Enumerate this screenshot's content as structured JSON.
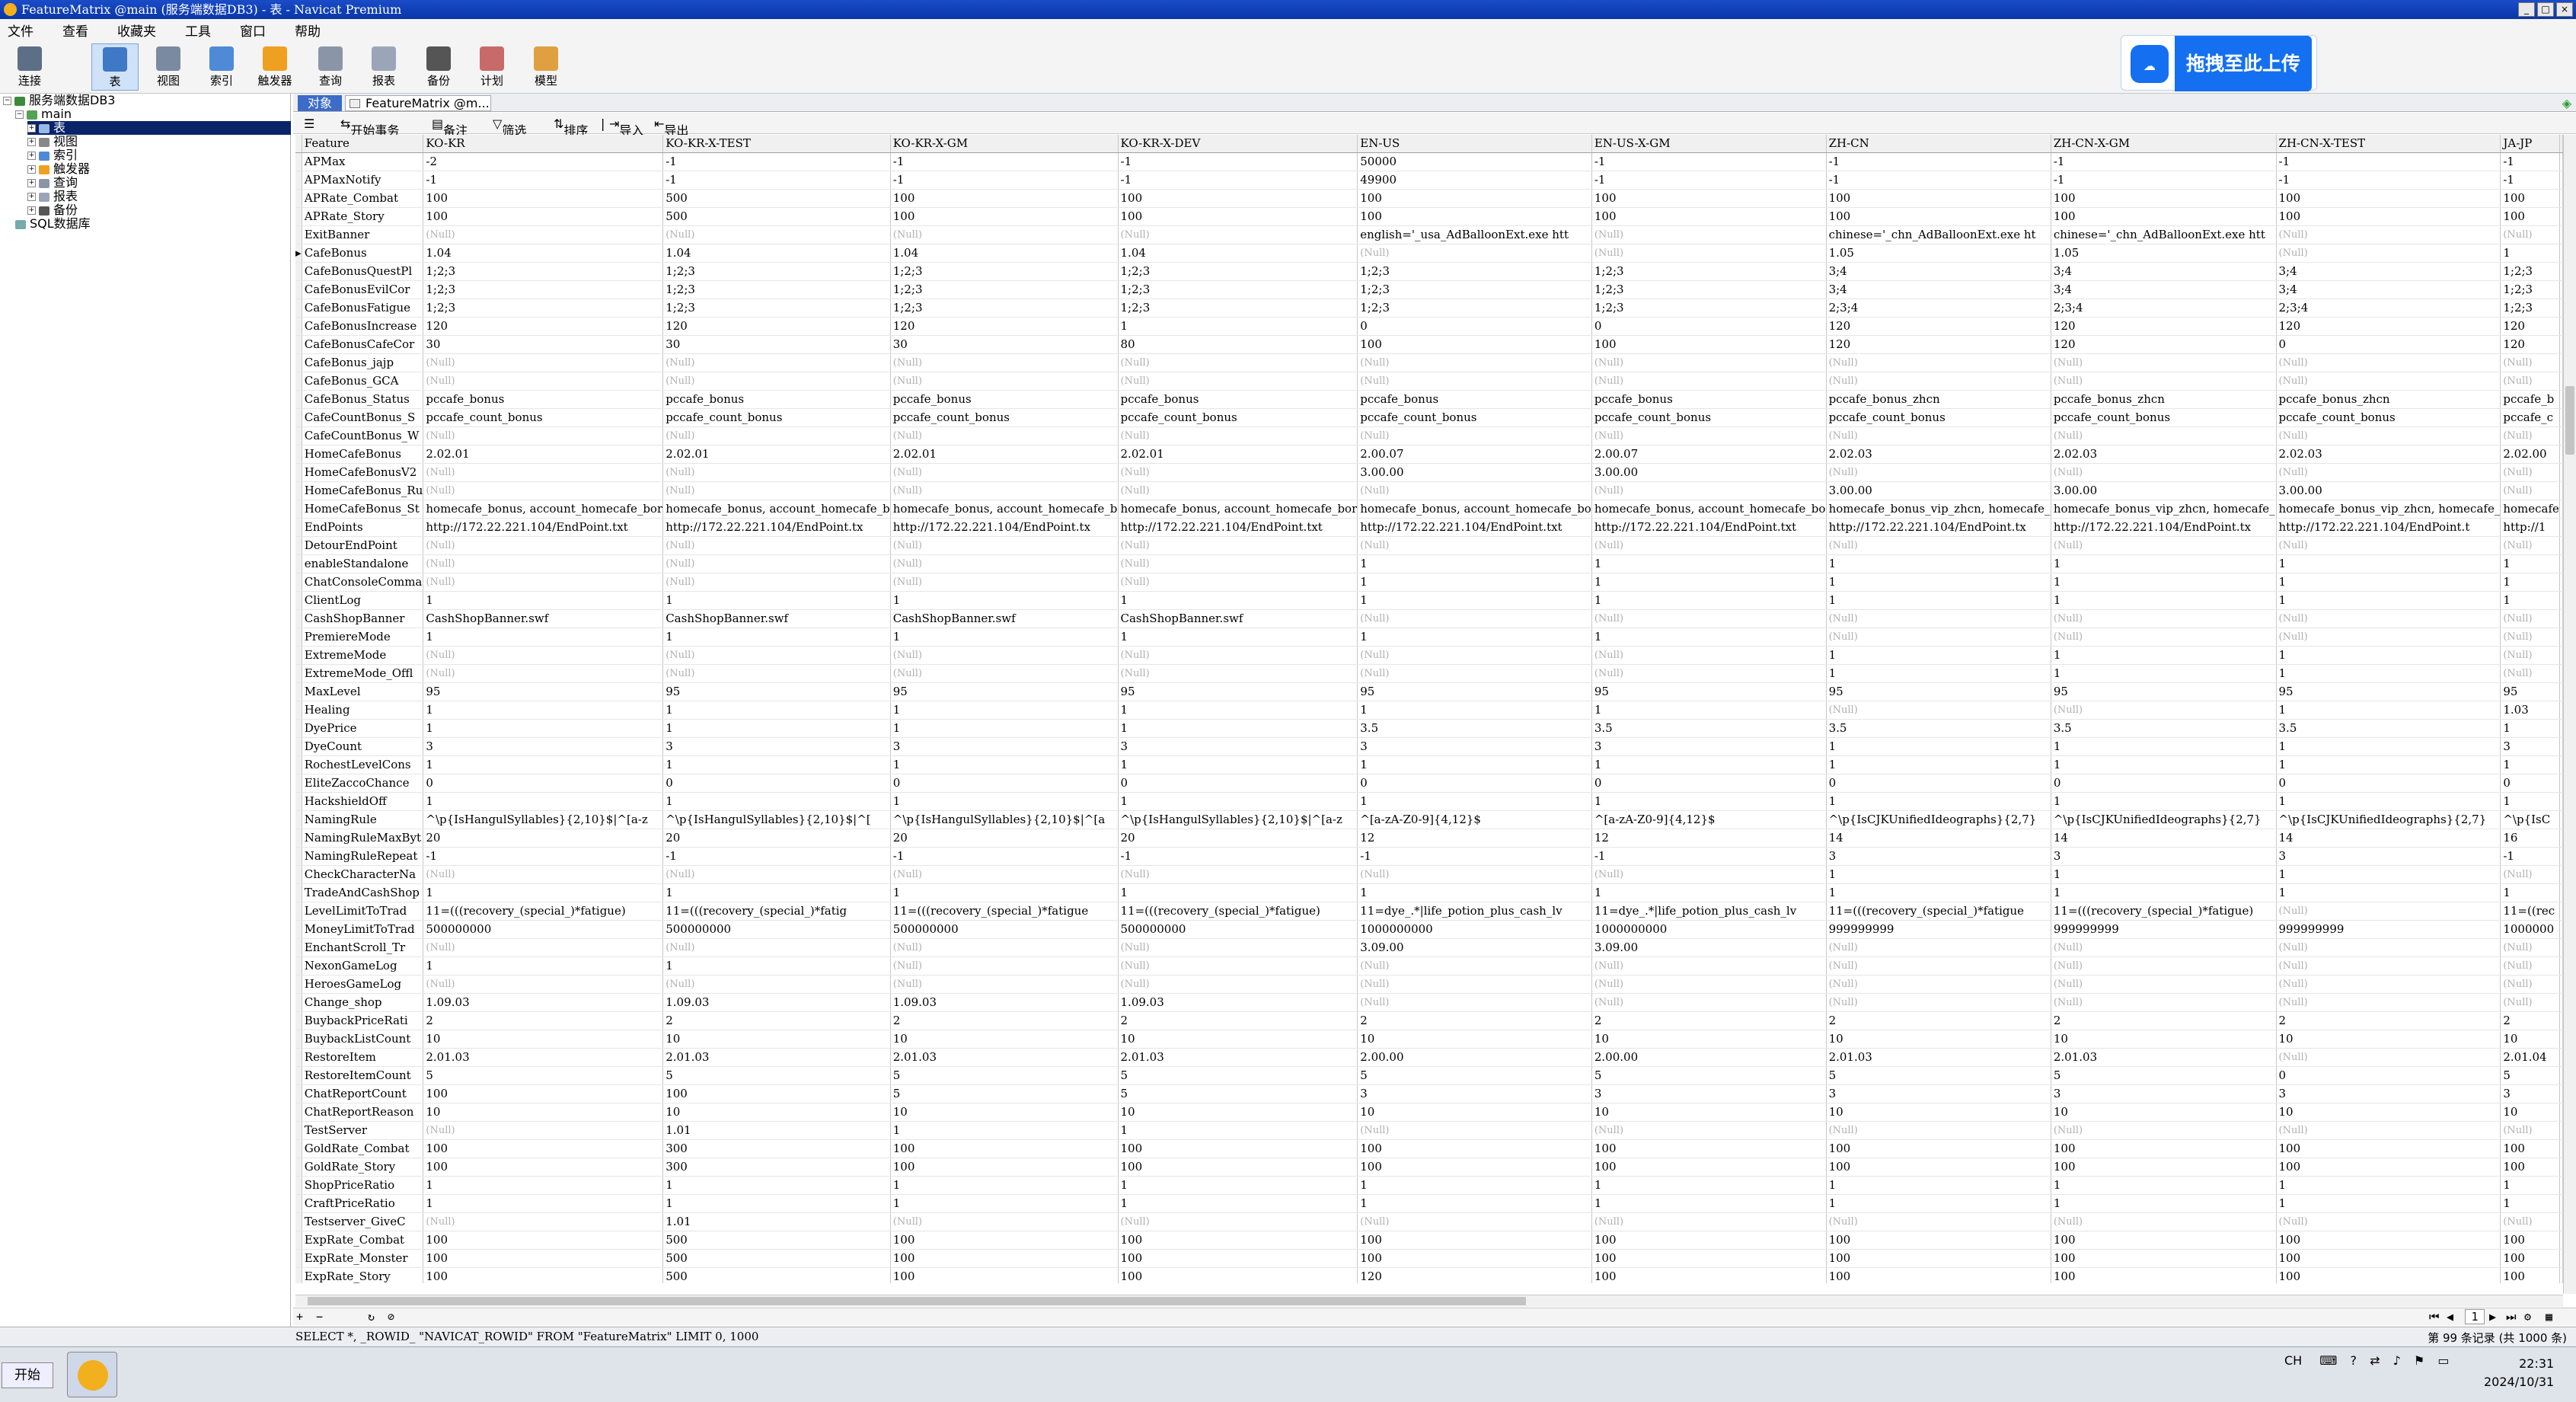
{
  "window": {
    "title": "FeatureMatrix @main (服务端数据DB3) - 表 - Navicat Premium"
  },
  "menu": [
    "文件",
    "查看",
    "收藏夹",
    "工具",
    "窗口",
    "帮助"
  ],
  "toolbar": [
    "连接",
    "表",
    "视图",
    "索引",
    "触发器",
    "查询",
    "报表",
    "备份",
    "计划",
    "模型"
  ],
  "upload": {
    "label": "拖拽至此上传"
  },
  "tree": [
    {
      "label": "服务端数据DB3",
      "level": 0
    },
    {
      "label": "main",
      "level": 1
    },
    {
      "label": "表",
      "level": 2
    },
    {
      "label": "视图",
      "level": 2
    },
    {
      "label": "索引",
      "level": 2
    },
    {
      "label": "触发器",
      "level": 2
    },
    {
      "label": "查询",
      "level": 2
    },
    {
      "label": "报表",
      "level": 2
    },
    {
      "label": "备份",
      "level": 2
    },
    {
      "label": "SQL数据库",
      "level": 0
    }
  ],
  "tabs": {
    "objects": "对象",
    "table": "FeatureMatrix @m..."
  },
  "objbar": {
    "begin": "开始事务",
    "note": "备注",
    "filter": "筛选",
    "sort": "排序",
    "import": "导入",
    "export": "导出"
  },
  "grid": {
    "columns": [
      "Feature",
      "KO-KR",
      "KO-KR-X-TEST",
      "KO-KR-X-GM",
      "KO-KR-X-DEV",
      "EN-US",
      "EN-US-X-GM",
      "ZH-CN",
      "ZH-CN-X-GM",
      "ZH-CN-X-TEST",
      "JA-JP"
    ],
    "rows": [
      [
        "APMax",
        "-2",
        "-1",
        "-1",
        "-1",
        "50000",
        "-1",
        "-1",
        "-1",
        "-1",
        "-1"
      ],
      [
        "APMaxNotify",
        "-1",
        "-1",
        "-1",
        "-1",
        "49900",
        "-1",
        "-1",
        "-1",
        "-1",
        "-1"
      ],
      [
        "APRate_Combat",
        "100",
        "500",
        "100",
        "100",
        "100",
        "100",
        "100",
        "100",
        "100",
        "100"
      ],
      [
        "APRate_Story",
        "100",
        "500",
        "100",
        "100",
        "100",
        "100",
        "100",
        "100",
        "100",
        "100"
      ],
      [
        "ExitBanner",
        "(Null)",
        "(Null)",
        "(Null)",
        "(Null)",
        "english='_usa_AdBalloonExt.exe htt",
        "(Null)",
        "chinese='_chn_AdBalloonExt.exe ht",
        "chinese='_chn_AdBalloonExt.exe htt",
        "(Null)",
        "(Null)"
      ],
      [
        "CafeBonus",
        "1.04",
        "1.04",
        "1.04",
        "1.04",
        "(Null)",
        "(Null)",
        "1.05",
        "1.05",
        "(Null)",
        "1"
      ],
      [
        "CafeBonusQuestPl",
        "1;2;3",
        "1;2;3",
        "1;2;3",
        "1;2;3",
        "1;2;3",
        "1;2;3",
        "3;4",
        "3;4",
        "3;4",
        "1;2;3"
      ],
      [
        "CafeBonusEvilCor",
        "1;2;3",
        "1;2;3",
        "1;2;3",
        "1;2;3",
        "1;2;3",
        "1;2;3",
        "3;4",
        "3;4",
        "3;4",
        "1;2;3"
      ],
      [
        "CafeBonusFatigue",
        "1;2;3",
        "1;2;3",
        "1;2;3",
        "1;2;3",
        "1;2;3",
        "1;2;3",
        "2;3;4",
        "2;3;4",
        "2;3;4",
        "1;2;3"
      ],
      [
        "CafeBonusIncrease",
        "120",
        "120",
        "120",
        "1",
        "0",
        "0",
        "120",
        "120",
        "120",
        "120"
      ],
      [
        "CafeBonusCafeCor",
        "30",
        "30",
        "30",
        "80",
        "100",
        "100",
        "120",
        "120",
        "0",
        "120"
      ],
      [
        "CafeBonus_jajp",
        "(Null)",
        "(Null)",
        "(Null)",
        "(Null)",
        "(Null)",
        "(Null)",
        "(Null)",
        "(Null)",
        "(Null)",
        "(Null)"
      ],
      [
        "CafeBonus_GCA",
        "(Null)",
        "(Null)",
        "(Null)",
        "(Null)",
        "(Null)",
        "(Null)",
        "(Null)",
        "(Null)",
        "(Null)",
        "(Null)"
      ],
      [
        "CafeBonus_Status",
        "pccafe_bonus",
        "pccafe_bonus",
        "pccafe_bonus",
        "pccafe_bonus",
        "pccafe_bonus",
        "pccafe_bonus",
        "pccafe_bonus_zhcn",
        "pccafe_bonus_zhcn",
        "pccafe_bonus_zhcn",
        "pccafe_b"
      ],
      [
        "CafeCountBonus_S",
        "pccafe_count_bonus",
        "pccafe_count_bonus",
        "pccafe_count_bonus",
        "pccafe_count_bonus",
        "pccafe_count_bonus",
        "pccafe_count_bonus",
        "pccafe_count_bonus",
        "pccafe_count_bonus",
        "pccafe_count_bonus",
        "pccafe_c"
      ],
      [
        "CafeCountBonus_W",
        "(Null)",
        "(Null)",
        "(Null)",
        "(Null)",
        "(Null)",
        "(Null)",
        "(Null)",
        "(Null)",
        "(Null)",
        "(Null)"
      ],
      [
        "HomeCafeBonus",
        "2.02.01",
        "2.02.01",
        "2.02.01",
        "2.02.01",
        "2.00.07",
        "2.00.07",
        "2.02.03",
        "2.02.03",
        "2.02.03",
        "2.02.00"
      ],
      [
        "HomeCafeBonusV2",
        "(Null)",
        "(Null)",
        "(Null)",
        "(Null)",
        "3.00.00",
        "3.00.00",
        "(Null)",
        "(Null)",
        "(Null)",
        "(Null)"
      ],
      [
        "HomeCafeBonus_Ru",
        "(Null)",
        "(Null)",
        "(Null)",
        "(Null)",
        "(Null)",
        "(Null)",
        "3.00.00",
        "3.00.00",
        "3.00.00",
        "(Null)"
      ],
      [
        "HomeCafeBonus_St",
        "homecafe_bonus, account_homecafe_bor",
        "homecafe_bonus, account_homecafe_b",
        "homecafe_bonus, account_homecafe_b",
        "homecafe_bonus, account_homecafe_bor",
        "homecafe_bonus, account_homecafe_bo",
        "homecafe_bonus, account_homecafe_bo",
        "homecafe_bonus_vip_zhcn, homecafe_",
        "homecafe_bonus_vip_zhcn, homecafe_",
        "homecafe_bonus_vip_zhcn, homecafe_",
        "homecafe"
      ],
      [
        "EndPoints",
        "http://172.22.221.104/EndPoint.txt",
        "http://172.22.221.104/EndPoint.tx",
        "http://172.22.221.104/EndPoint.tx",
        "http://172.22.221.104/EndPoint.txt",
        "http://172.22.221.104/EndPoint.txt",
        "http://172.22.221.104/EndPoint.txt",
        "http://172.22.221.104/EndPoint.tx",
        "http://172.22.221.104/EndPoint.tx",
        "http://172.22.221.104/EndPoint.t",
        "http://1"
      ],
      [
        "DetourEndPoint",
        "(Null)",
        "(Null)",
        "(Null)",
        "(Null)",
        "(Null)",
        "(Null)",
        "(Null)",
        "(Null)",
        "(Null)",
        "(Null)"
      ],
      [
        "enableStandalone",
        "(Null)",
        "(Null)",
        "(Null)",
        "(Null)",
        "1",
        "1",
        "1",
        "1",
        "1",
        "1"
      ],
      [
        "ChatConsoleComma",
        "(Null)",
        "(Null)",
        "(Null)",
        "(Null)",
        "1",
        "1",
        "1",
        "1",
        "1",
        "1"
      ],
      [
        "ClientLog",
        "1",
        "1",
        "1",
        "1",
        "1",
        "1",
        "1",
        "1",
        "1",
        "1"
      ],
      [
        "CashShopBanner",
        "CashShopBanner.swf",
        "CashShopBanner.swf",
        "CashShopBanner.swf",
        "CashShopBanner.swf",
        "(Null)",
        "(Null)",
        "(Null)",
        "(Null)",
        "(Null)",
        "(Null)"
      ],
      [
        "PremiereMode",
        "1",
        "1",
        "1",
        "1",
        "1",
        "1",
        "(Null)",
        "(Null)",
        "(Null)",
        "(Null)"
      ],
      [
        "ExtremeMode",
        "(Null)",
        "(Null)",
        "(Null)",
        "(Null)",
        "(Null)",
        "(Null)",
        "1",
        "1",
        "1",
        "(Null)"
      ],
      [
        "ExtremeMode_Offl",
        "(Null)",
        "(Null)",
        "(Null)",
        "(Null)",
        "(Null)",
        "(Null)",
        "1",
        "1",
        "1",
        "(Null)"
      ],
      [
        "MaxLevel",
        "95",
        "95",
        "95",
        "95",
        "95",
        "95",
        "95",
        "95",
        "95",
        "95"
      ],
      [
        "Healing",
        "1",
        "1",
        "1",
        "1",
        "1",
        "1",
        "(Null)",
        "(Null)",
        "1",
        "1.03"
      ],
      [
        "DyePrice",
        "1",
        "1",
        "1",
        "1",
        "3.5",
        "3.5",
        "3.5",
        "3.5",
        "3.5",
        "1"
      ],
      [
        "DyeCount",
        "3",
        "3",
        "3",
        "3",
        "3",
        "3",
        "1",
        "1",
        "1",
        "3"
      ],
      [
        "RochestLevelCons",
        "1",
        "1",
        "1",
        "1",
        "1",
        "1",
        "1",
        "1",
        "1",
        "1"
      ],
      [
        "EliteZaccoChance",
        "0",
        "0",
        "0",
        "0",
        "0",
        "0",
        "0",
        "0",
        "0",
        "0"
      ],
      [
        "HackshieldOff",
        "1",
        "1",
        "1",
        "1",
        "1",
        "1",
        "1",
        "1",
        "1",
        "1"
      ],
      [
        "NamingRule",
        "^\\p{IsHangulSyllables}{2,10}$|^[a-z",
        "^\\p{IsHangulSyllables}{2,10}$|^[",
        "^\\p{IsHangulSyllables}{2,10}$|^[a",
        "^\\p{IsHangulSyllables}{2,10}$|^[a-z",
        "^[a-zA-Z0-9]{4,12}$",
        "^[a-zA-Z0-9]{4,12}$",
        "^\\p{IsCJKUnifiedIdeographs}{2,7}",
        "^\\p{IsCJKUnifiedIdeographs}{2,7}",
        "^\\p{IsCJKUnifiedIdeographs}{2,7}",
        "^\\p{IsC"
      ],
      [
        "NamingRuleMaxByt",
        "20",
        "20",
        "20",
        "20",
        "12",
        "12",
        "14",
        "14",
        "14",
        "16"
      ],
      [
        "NamingRuleRepeat",
        "-1",
        "-1",
        "-1",
        "-1",
        "-1",
        "-1",
        "3",
        "3",
        "3",
        "-1"
      ],
      [
        "CheckCharacterNa",
        "(Null)",
        "(Null)",
        "(Null)",
        "(Null)",
        "(Null)",
        "(Null)",
        "1",
        "1",
        "1",
        "(Null)"
      ],
      [
        "TradeAndCashShop",
        "1",
        "1",
        "1",
        "1",
        "1",
        "1",
        "1",
        "1",
        "1",
        "1"
      ],
      [
        "LevelLimitToTrad",
        "11=(((recovery_(special_)*fatigue)",
        "11=(((recovery_(special_)*fatig",
        "11=(((recovery_(special_)*fatigue",
        "11=(((recovery_(special_)*fatigue)",
        "11=dye_.*|life_potion_plus_cash_lv",
        "11=dye_.*|life_potion_plus_cash_lv",
        "11=(((recovery_(special_)*fatigue",
        "11=(((recovery_(special_)*fatigue)",
        "(Null)",
        "11=((rec"
      ],
      [
        "MoneyLimitToTrad",
        "500000000",
        "500000000",
        "500000000",
        "500000000",
        "1000000000",
        "1000000000",
        "999999999",
        "999999999",
        "999999999",
        "1000000"
      ],
      [
        "EnchantScroll_Tr",
        "(Null)",
        "(Null)",
        "(Null)",
        "(Null)",
        "3.09.00",
        "3.09.00",
        "(Null)",
        "(Null)",
        "(Null)",
        "(Null)"
      ],
      [
        "NexonGameLog",
        "1",
        "1",
        "(Null)",
        "(Null)",
        "(Null)",
        "(Null)",
        "(Null)",
        "(Null)",
        "(Null)",
        "(Null)"
      ],
      [
        "HeroesGameLog",
        "(Null)",
        "(Null)",
        "(Null)",
        "(Null)",
        "(Null)",
        "(Null)",
        "(Null)",
        "(Null)",
        "(Null)",
        "(Null)"
      ],
      [
        "Change_shop",
        "1.09.03",
        "1.09.03",
        "1.09.03",
        "1.09.03",
        "(Null)",
        "(Null)",
        "(Null)",
        "(Null)",
        "(Null)",
        "(Null)"
      ],
      [
        "BuybackPriceRati",
        "2",
        "2",
        "2",
        "2",
        "2",
        "2",
        "2",
        "2",
        "2",
        "2"
      ],
      [
        "BuybackListCount",
        "10",
        "10",
        "10",
        "10",
        "10",
        "10",
        "10",
        "10",
        "10",
        "10"
      ],
      [
        "RestoreItem",
        "2.01.03",
        "2.01.03",
        "2.01.03",
        "2.01.03",
        "2.00.00",
        "2.00.00",
        "2.01.03",
        "2.01.03",
        "(Null)",
        "2.01.04"
      ],
      [
        "RestoreItemCount",
        "5",
        "5",
        "5",
        "5",
        "5",
        "5",
        "5",
        "5",
        "0",
        "5"
      ],
      [
        "ChatReportCount",
        "100",
        "100",
        "5",
        "5",
        "3",
        "3",
        "3",
        "3",
        "3",
        "3"
      ],
      [
        "ChatReportReason",
        "10",
        "10",
        "10",
        "10",
        "10",
        "10",
        "10",
        "10",
        "10",
        "10"
      ],
      [
        "TestServer",
        "(Null)",
        "1.01",
        "1",
        "1",
        "(Null)",
        "(Null)",
        "(Null)",
        "(Null)",
        "(Null)",
        "(Null)"
      ],
      [
        "GoldRate_Combat",
        "100",
        "300",
        "100",
        "100",
        "100",
        "100",
        "100",
        "100",
        "100",
        "100"
      ],
      [
        "GoldRate_Story",
        "100",
        "300",
        "100",
        "100",
        "100",
        "100",
        "100",
        "100",
        "100",
        "100"
      ],
      [
        "ShopPriceRatio",
        "1",
        "1",
        "1",
        "1",
        "1",
        "1",
        "1",
        "1",
        "1",
        "1"
      ],
      [
        "CraftPriceRatio",
        "1",
        "1",
        "1",
        "1",
        "1",
        "1",
        "1",
        "1",
        "1",
        "1"
      ],
      [
        "Testserver_GiveC",
        "(Null)",
        "1.01",
        "(Null)",
        "(Null)",
        "(Null)",
        "(Null)",
        "(Null)",
        "(Null)",
        "(Null)",
        "(Null)"
      ],
      [
        "ExpRate_Combat",
        "100",
        "500",
        "100",
        "100",
        "100",
        "100",
        "100",
        "100",
        "100",
        "100"
      ],
      [
        "ExpRate_Monster",
        "100",
        "500",
        "100",
        "100",
        "100",
        "100",
        "100",
        "100",
        "100",
        "100"
      ],
      [
        "ExpRate_Story",
        "100",
        "500",
        "100",
        "100",
        "120",
        "100",
        "100",
        "100",
        "100",
        "100"
      ]
    ]
  },
  "nav": {
    "page": "1"
  },
  "status": {
    "sql": "SELECT *, _ROWID_ \"NAVICAT_ROWID\" FROM \"FeatureMatrix\" LIMIT 0, 1000",
    "count": "第 99 条记录 (共 1000 条)"
  },
  "taskbar": {
    "start": "开始",
    "lang": "CH",
    "time": "22:31",
    "date": "2024/10/31"
  }
}
